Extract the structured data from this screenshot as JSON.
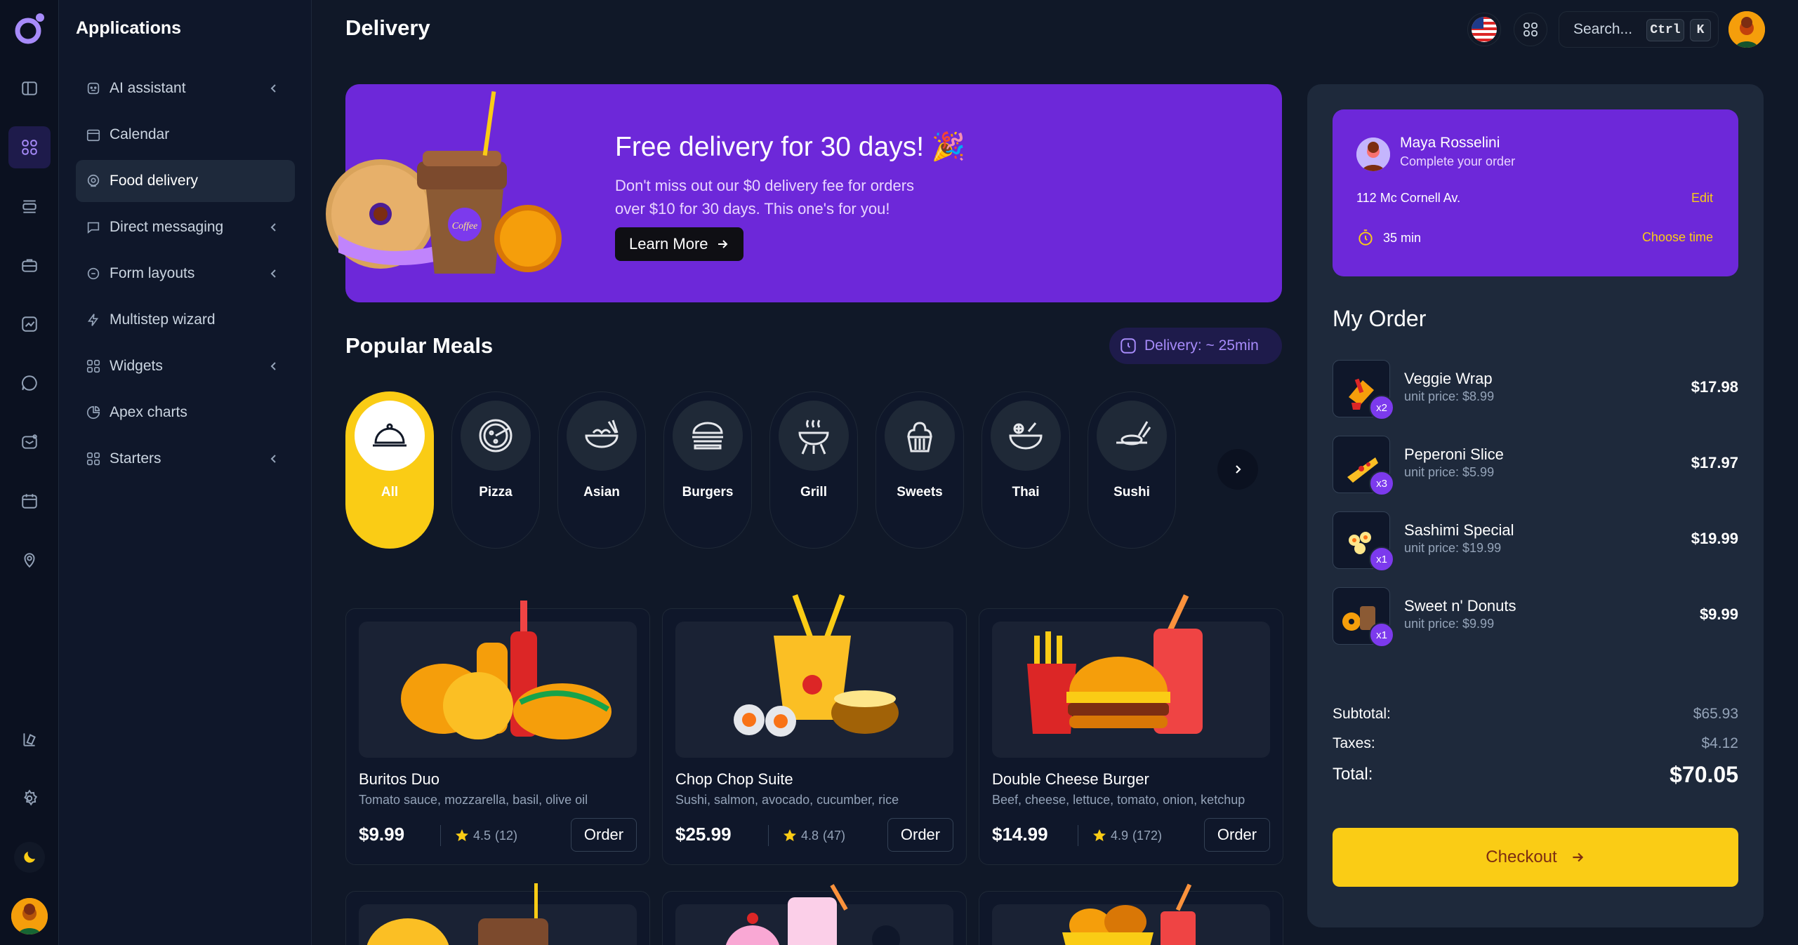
{
  "sidebar": {
    "title": "Applications",
    "items": [
      {
        "label": "AI assistant",
        "icon": "robot-icon",
        "submenu": true
      },
      {
        "label": "Calendar",
        "icon": "calendar-icon",
        "submenu": false
      },
      {
        "label": "Food delivery",
        "icon": "location-icon",
        "submenu": false,
        "active": true
      },
      {
        "label": "Direct messaging",
        "icon": "chat-icon",
        "submenu": true
      },
      {
        "label": "Form layouts",
        "icon": "form-icon",
        "submenu": true
      },
      {
        "label": "Multistep wizard",
        "icon": "wizard-icon",
        "submenu": false
      },
      {
        "label": "Widgets",
        "icon": "grid-icon",
        "submenu": true
      },
      {
        "label": "Apex charts",
        "icon": "pie-chart-icon",
        "submenu": false
      },
      {
        "label": "Starters",
        "icon": "grid-icon",
        "submenu": true
      }
    ]
  },
  "header": {
    "title": "Delivery",
    "search_label": "Search...",
    "kbd_ctrl": "Ctrl",
    "kbd_k": "K"
  },
  "banner": {
    "title": "Free delivery for 30 days!",
    "emoji": "🎉",
    "text": "Don't miss out our $0 delivery fee for orders over $10 for 30 days. This one's for you!",
    "button": "Learn More",
    "cup_label": "Coffee"
  },
  "popular": {
    "title": "Popular Meals",
    "delivery_pill": "Delivery: ~ 25min",
    "categories": [
      {
        "label": "All",
        "icon": "cloche-icon",
        "active": true
      },
      {
        "label": "Pizza",
        "icon": "pizza-icon"
      },
      {
        "label": "Asian",
        "icon": "noodle-bowl-icon"
      },
      {
        "label": "Burgers",
        "icon": "burger-icon"
      },
      {
        "label": "Grill",
        "icon": "grill-icon"
      },
      {
        "label": "Sweets",
        "icon": "cupcake-icon"
      },
      {
        "label": "Thai",
        "icon": "salad-bowl-icon"
      },
      {
        "label": "Sushi",
        "icon": "sushi-icon"
      }
    ]
  },
  "meals": [
    {
      "name": "Buritos Duo",
      "desc": "Tomato sauce, mozzarella, basil, olive oil",
      "price": "$9.99",
      "rating": "4.5",
      "count": "(12)",
      "order": "Order"
    },
    {
      "name": "Chop Chop Suite",
      "desc": "Sushi, salmon, avocado, cucumber, rice",
      "price": "$25.99",
      "rating": "4.8",
      "count": "(47)",
      "order": "Order"
    },
    {
      "name": "Double Cheese Burger",
      "desc": "Beef, cheese, lettuce, tomato, onion, ketchup",
      "price": "$14.99",
      "rating": "4.9",
      "count": "(172)",
      "order": "Order"
    }
  ],
  "order_card": {
    "name": "Maya Rosselini",
    "subtitle": "Complete your order",
    "address": "112 Mc Cornell Av.",
    "edit": "Edit",
    "time": "35 min",
    "choose_time": "Choose time"
  },
  "my_order": {
    "title": "My Order",
    "items": [
      {
        "name": "Veggie Wrap",
        "unit": "unit price: $8.99",
        "qty": "x2",
        "price": "$17.98"
      },
      {
        "name": "Peperoni Slice",
        "unit": "unit price: $5.99",
        "qty": "x3",
        "price": "$17.97"
      },
      {
        "name": "Sashimi Special",
        "unit": "unit price: $19.99",
        "qty": "x1",
        "price": "$19.99"
      },
      {
        "name": "Sweet n' Donuts",
        "unit": "unit price: $9.99",
        "qty": "x1",
        "price": "$9.99"
      }
    ],
    "subtotal_label": "Subtotal:",
    "subtotal": "$65.93",
    "taxes_label": "Taxes:",
    "taxes": "$4.12",
    "total_label": "Total:",
    "total": "$70.05",
    "checkout": "Checkout"
  },
  "colors": {
    "accent": "#6d28d9",
    "highlight": "#facc15",
    "background": "#101828"
  }
}
